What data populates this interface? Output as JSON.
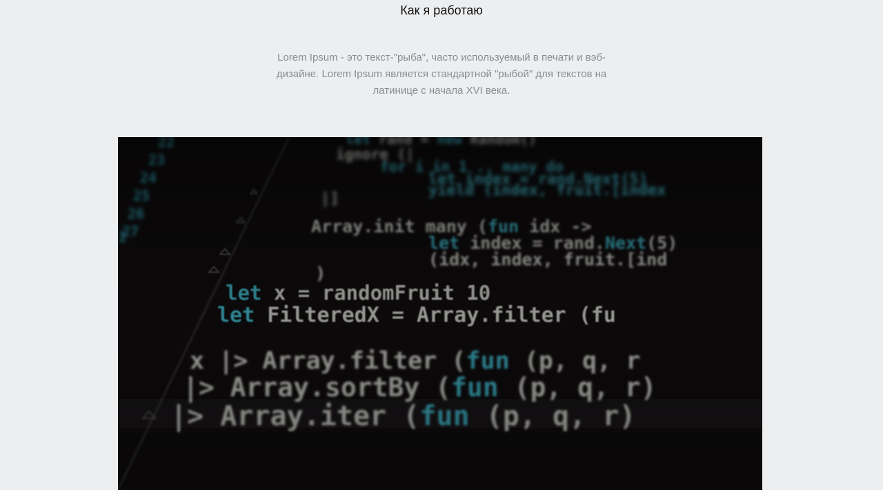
{
  "section": {
    "title": "Как я работаю",
    "intro": "Lorem Ipsum - это текст-\"рыба\", часто используемый в печати и вэб-дизайне. Lorem Ipsum является стандартной \"рыбой\" для текстов на латинице с начала XVI века."
  },
  "photo": {
    "subject": "blurred code editor screen",
    "code_lines": [
      "let rand = new Random()",
      "ignore (|",
      "for i in 1 .. many do",
      "let index = rand.Next(5)",
      "yield (index, fruit.[index",
      "|]",
      "Array.init many (fun idx ->",
      "let index = rand.Next(5)",
      "(idx, index, fruit.[ind",
      ")",
      "let x = randomFruit 10",
      "let FilteredX = Array.filter (fu",
      "x |> Array.filter (fun (p, q, r",
      "|> Array.sortBy (fun (p, q, r)",
      "|> Array.iter (fun (p, q, r)"
    ]
  },
  "colors": {
    "background": "#edeef0",
    "heading": "#111111",
    "intro_text": "#8a8c90",
    "code_plain": "#cfcfc9",
    "code_keyword": "#3fb6c9"
  }
}
